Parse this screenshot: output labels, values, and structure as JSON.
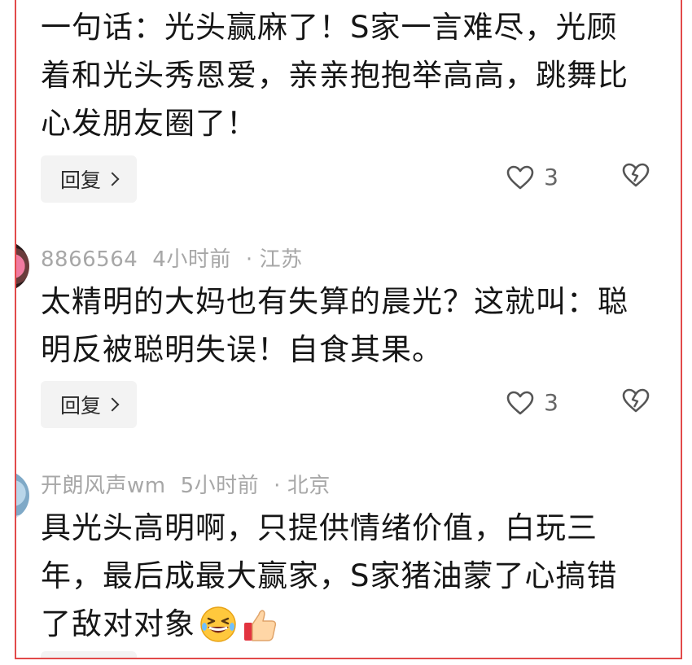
{
  "comments": [
    {
      "text_lines": [
        "一句话：光头赢麻了！S家一言难尽，光顾",
        "着和光头秀恩爱，亲亲抱抱举高高，跳舞比",
        "心发朋友圈了！"
      ],
      "reply_label": "回复",
      "likes": "3"
    },
    {
      "user": "8866564",
      "time": "4小时前",
      "location": "江苏",
      "text_lines": [
        "太精明的大妈也有失算的晨光？这就叫：聪",
        "明反被聪明失误！自食其果。"
      ],
      "reply_label": "回复",
      "likes": "3"
    },
    {
      "user": "开朗风声wm",
      "time": "5小时前",
      "location": "北京",
      "text_lines": [
        "具光头高明啊，只提供情绪价值，白玩三",
        "年，最后成最大赢家，S家猪油蒙了心搞错",
        "了敌对对象"
      ]
    }
  ],
  "separator": "·",
  "icons": {
    "like": "heart-outline-icon",
    "dislike": "broken-heart-icon",
    "reply_chevron": "chevron-right-icon",
    "emoji_1": "grinning-squint-emoji-icon",
    "emoji_2": "thumbs-up-emoji-icon"
  },
  "colors": {
    "frame_border": "#e24a4a",
    "meta_text": "#a7a7a7",
    "body_text": "#161616",
    "pill_bg": "#f3f3f3"
  }
}
